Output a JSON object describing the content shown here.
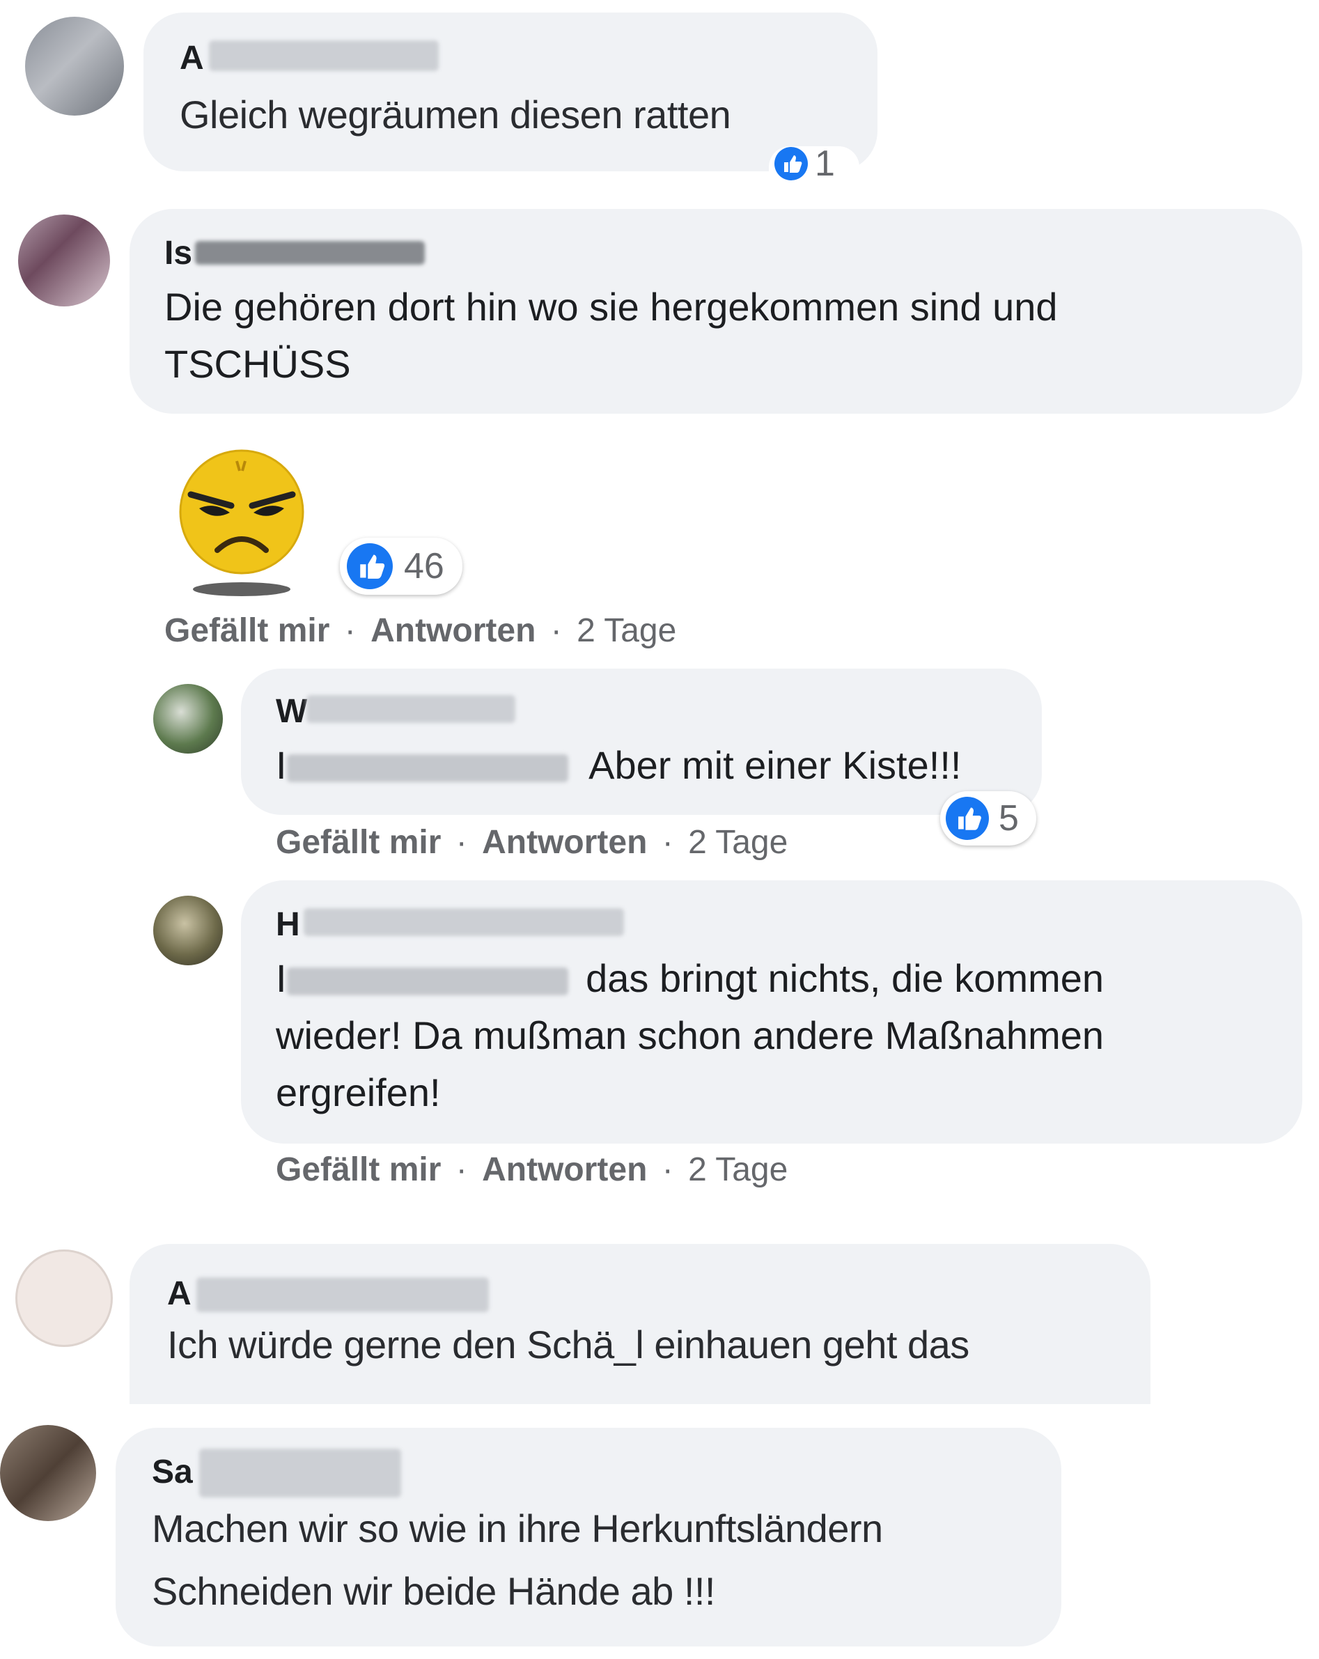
{
  "colors": {
    "bubble": "#f0f2f5",
    "like_blue": "#1877f2",
    "meta_grey": "#65676b",
    "text": "#1c1e21"
  },
  "comments": [
    {
      "name_prefix": "A",
      "text": "Gleich wegräumen diesen ratten",
      "likes": "1"
    },
    {
      "name_prefix": "Is",
      "text_line1": "Die gehören dort hin wo sie hergekommen sind und",
      "text_line2": "TSCHÜSS",
      "likes": "46",
      "sticker": "angry-emoji-sticker",
      "meta": {
        "like": "Gefällt mir",
        "reply": "Antworten",
        "time": "2 Tage"
      }
    },
    {
      "name_prefix": "W",
      "mention_prefix": "I",
      "text": "Aber mit einer Kiste!!!",
      "likes": "5",
      "meta": {
        "like": "Gefällt mir",
        "reply": "Antworten",
        "time": "2 Tage"
      }
    },
    {
      "name_prefix": "H",
      "mention_prefix": "I",
      "text_line1": "das bringt nichts, die kommen",
      "text_line2": "wieder! Da mußman schon andere Maßnahmen",
      "text_line3": "ergreifen!",
      "meta": {
        "like": "Gefällt mir",
        "reply": "Antworten",
        "time": "2 Tage"
      }
    },
    {
      "name_prefix": "A",
      "text": "Ich würde gerne den Schä_l einhauen geht das"
    },
    {
      "name_prefix": "Sa",
      "text_line1": "Machen wir so wie in ihre Herkunftsländern",
      "text_line2": "Schneiden wir beide Hände ab !!!"
    }
  ],
  "separator": "·"
}
